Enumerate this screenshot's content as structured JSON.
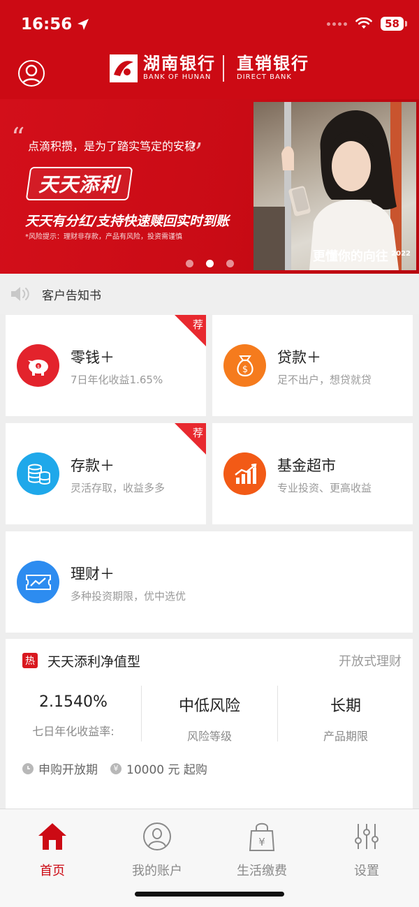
{
  "status": {
    "time": "16:56",
    "battery": "58"
  },
  "header": {
    "logo_cn": "湖南银行",
    "logo_en": "BANK OF HUNAN",
    "direct_cn": "直销银行",
    "direct_en": "DIRECT BANK",
    "accent": "#cc0a14"
  },
  "banner": {
    "slogan": "点滴积攒，是为了踏实笃定的安稳",
    "product": "天天添利",
    "feature": "天天有分红/支持快速赎回实时到账",
    "risk_note": "*风险提示：理财非存款，产品有风险，投资需谨慎",
    "photo_caption": "更懂你的向往",
    "photo_year": "2022",
    "active_slide": 2,
    "slide_count": 3
  },
  "notice": {
    "text": "客户告知书",
    "icon": "speaker-icon"
  },
  "cards": [
    {
      "title": "零钱＋",
      "subtitle": "7日年化收益1.65%",
      "icon": "piggy-bank-icon",
      "color": "#e3232c",
      "badge": "荐"
    },
    {
      "title": "贷款＋",
      "subtitle": "足不出户，想贷就贷",
      "icon": "money-bag-icon",
      "color": "#f57b1d"
    },
    {
      "title": "存款＋",
      "subtitle": "灵活存取，收益多多",
      "icon": "coins-icon",
      "color": "#1fa8ea",
      "badge": "荐"
    },
    {
      "title": "基金超市",
      "subtitle": "专业投资、更高收益",
      "icon": "bar-chart-icon",
      "color": "#f25a16"
    },
    {
      "title": "理财＋",
      "subtitle": "多种投资期限，优中选优",
      "icon": "ticket-chart-icon",
      "color": "#2d8cf0"
    }
  ],
  "product": {
    "hot_label": "热",
    "name": "天天添利净值型",
    "type": "开放式理财",
    "stats": [
      {
        "value": "2.1540%",
        "label": "七日年化收益率:"
      },
      {
        "value": "中低风险",
        "label": "风险等级"
      },
      {
        "value": "长期",
        "label": "产品期限"
      }
    ],
    "open_period": "申购开放期",
    "min_amount": "10000 元 起购"
  },
  "tabs": [
    {
      "label": "首页",
      "icon": "home-icon",
      "active": true
    },
    {
      "label": "我的账户",
      "icon": "user-circle-icon",
      "active": false
    },
    {
      "label": "生活缴费",
      "icon": "shopping-bag-yen-icon",
      "active": false
    },
    {
      "label": "设置",
      "icon": "sliders-icon",
      "active": false
    }
  ]
}
